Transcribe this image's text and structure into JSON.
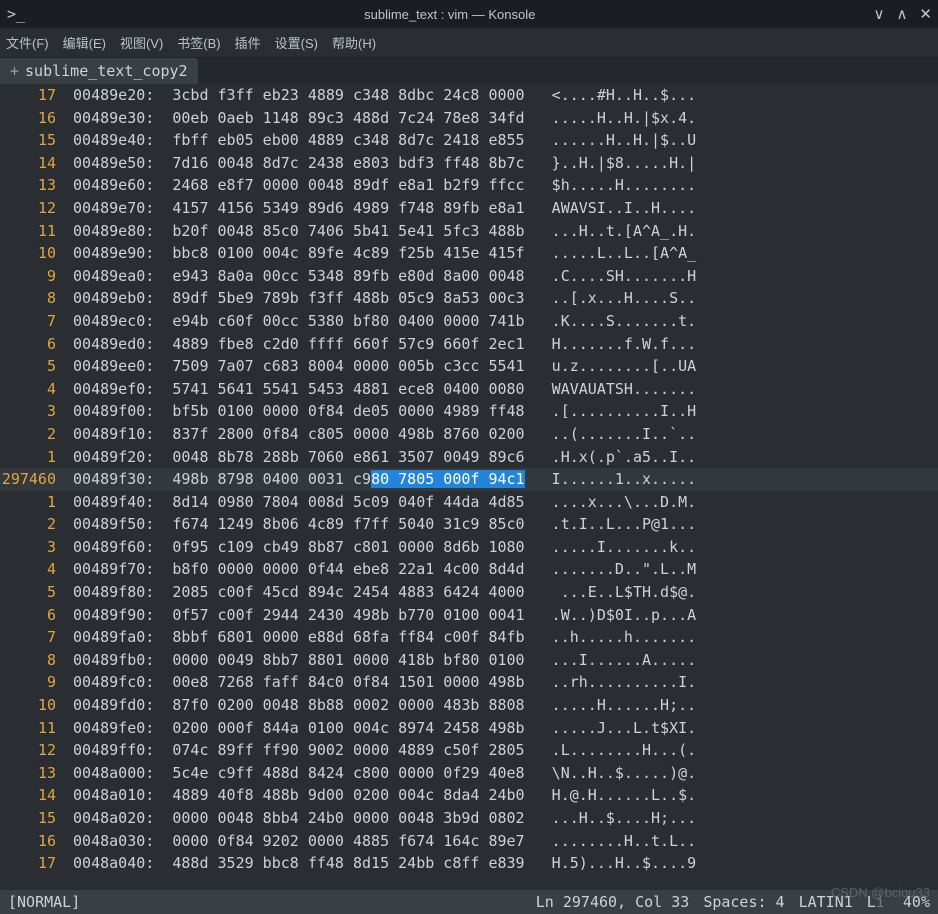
{
  "window": {
    "title": "sublime_text : vim — Konsole",
    "min_icon": "∨",
    "max_icon": "∧",
    "close_icon": "✕",
    "app_icon": ">_"
  },
  "menu": {
    "file": "文件(F)",
    "edit": "编辑(E)",
    "view": "视图(V)",
    "bookmarks": "书签(B)",
    "plugins": "插件",
    "settings": "设置(S)",
    "help": "帮助(H)"
  },
  "tabs": {
    "current": {
      "prefix": "+",
      "label": "sublime_text_copy2"
    }
  },
  "hex": {
    "cursor_row": 17,
    "cursor_col_start": 38,
    "rows": [
      {
        "ln": "17",
        "addr": "00489e20:",
        "bytes": "3cbd f3ff eb23 4889 c348 8dbc 24c8 0000",
        "ascii": "<....#H..H..$..."
      },
      {
        "ln": "16",
        "addr": "00489e30:",
        "bytes": "00eb 0aeb 1148 89c3 488d 7c24 78e8 34fd",
        "ascii": ".....H..H.|$x.4."
      },
      {
        "ln": "15",
        "addr": "00489e40:",
        "bytes": "fbff eb05 eb00 4889 c348 8d7c 2418 e855",
        "ascii": "......H..H.|$..U"
      },
      {
        "ln": "14",
        "addr": "00489e50:",
        "bytes": "7d16 0048 8d7c 2438 e803 bdf3 ff48 8b7c",
        "ascii": "}..H.|$8.....H.|"
      },
      {
        "ln": "13",
        "addr": "00489e60:",
        "bytes": "2468 e8f7 0000 0048 89df e8a1 b2f9 ffcc",
        "ascii": "$h.....H........"
      },
      {
        "ln": "12",
        "addr": "00489e70:",
        "bytes": "4157 4156 5349 89d6 4989 f748 89fb e8a1",
        "ascii": "AWAVSI..I..H...."
      },
      {
        "ln": "11",
        "addr": "00489e80:",
        "bytes": "b20f 0048 85c0 7406 5b41 5e41 5fc3 488b",
        "ascii": "...H..t.[A^A_.H."
      },
      {
        "ln": "10",
        "addr": "00489e90:",
        "bytes": "bbc8 0100 004c 89fe 4c89 f25b 415e 415f",
        "ascii": ".....L..L..[A^A_"
      },
      {
        "ln": "9",
        "addr": "00489ea0:",
        "bytes": "e943 8a0a 00cc 5348 89fb e80d 8a00 0048",
        "ascii": ".C....SH.......H"
      },
      {
        "ln": "8",
        "addr": "00489eb0:",
        "bytes": "89df 5be9 789b f3ff 488b 05c9 8a53 00c3",
        "ascii": "..[.x...H....S.."
      },
      {
        "ln": "7",
        "addr": "00489ec0:",
        "bytes": "e94b c60f 00cc 5380 bf80 0400 0000 741b",
        "ascii": ".K....S.......t."
      },
      {
        "ln": "6",
        "addr": "00489ed0:",
        "bytes": "4889 fbe8 c2d0 ffff 660f 57c9 660f 2ec1",
        "ascii": "H.......f.W.f..."
      },
      {
        "ln": "5",
        "addr": "00489ee0:",
        "bytes": "7509 7a07 c683 8004 0000 005b c3cc 5541",
        "ascii": "u.z........[..UA"
      },
      {
        "ln": "4",
        "addr": "00489ef0:",
        "bytes": "5741 5641 5541 5453 4881 ece8 0400 0080",
        "ascii": "WAVAUATSH......."
      },
      {
        "ln": "3",
        "addr": "00489f00:",
        "bytes": "bf5b 0100 0000 0f84 de05 0000 4989 ff48",
        "ascii": ".[..........I..H"
      },
      {
        "ln": "2",
        "addr": "00489f10:",
        "bytes": "837f 2800 0f84 c805 0000 498b 8760 0200",
        "ascii": "..(.......I..`.."
      },
      {
        "ln": "1",
        "addr": "00489f20:",
        "bytes": "0048 8b78 288b 7060 e861 3507 0049 89c6",
        "ascii": ".H.x(.p`.a5..I.."
      },
      {
        "ln": "297460",
        "addr": "00489f30:",
        "bytes_pre": "498b 8798 0400 0031 c9",
        "bytes_sel": "80 7805 000f 94c1",
        "ascii": "I......1..x.....",
        "is_cursor": true
      },
      {
        "ln": "1",
        "addr": "00489f40:",
        "bytes": "8d14 0980 7804 008d 5c09 040f 44da 4d85",
        "ascii": "....x...\\...D.M."
      },
      {
        "ln": "2",
        "addr": "00489f50:",
        "bytes": "f674 1249 8b06 4c89 f7ff 5040 31c9 85c0",
        "ascii": ".t.I..L...P@1..."
      },
      {
        "ln": "3",
        "addr": "00489f60:",
        "bytes": "0f95 c109 cb49 8b87 c801 0000 8d6b 1080",
        "ascii": ".....I.......k.."
      },
      {
        "ln": "4",
        "addr": "00489f70:",
        "bytes": "b8f0 0000 0000 0f44 ebe8 22a1 4c00 8d4d",
        "ascii": ".......D..\".L..M"
      },
      {
        "ln": "5",
        "addr": "00489f80:",
        "bytes": "2085 c00f 45cd 894c 2454 4883 6424 4000",
        "ascii": " ...E..L$TH.d$@."
      },
      {
        "ln": "6",
        "addr": "00489f90:",
        "bytes": "0f57 c00f 2944 2430 498b b770 0100 0041",
        "ascii": ".W..)D$0I..p...A"
      },
      {
        "ln": "7",
        "addr": "00489fa0:",
        "bytes": "8bbf 6801 0000 e88d 68fa ff84 c00f 84fb",
        "ascii": "..h.....h......."
      },
      {
        "ln": "8",
        "addr": "00489fb0:",
        "bytes": "0000 0049 8bb7 8801 0000 418b bf80 0100",
        "ascii": "...I......A....."
      },
      {
        "ln": "9",
        "addr": "00489fc0:",
        "bytes": "00e8 7268 faff 84c0 0f84 1501 0000 498b",
        "ascii": "..rh..........I."
      },
      {
        "ln": "10",
        "addr": "00489fd0:",
        "bytes": "87f0 0200 0048 8b88 0002 0000 483b 8808",
        "ascii": ".....H......H;.."
      },
      {
        "ln": "11",
        "addr": "00489fe0:",
        "bytes": "0200 000f 844a 0100 004c 8974 2458 498b",
        "ascii": ".....J...L.t$XI."
      },
      {
        "ln": "12",
        "addr": "00489ff0:",
        "bytes": "074c 89ff ff90 9002 0000 4889 c50f 2805",
        "ascii": ".L........H...(."
      },
      {
        "ln": "13",
        "addr": "0048a000:",
        "bytes": "5c4e c9ff 488d 8424 c800 0000 0f29 40e8",
        "ascii": "\\N..H..$.....)@."
      },
      {
        "ln": "14",
        "addr": "0048a010:",
        "bytes": "4889 40f8 488b 9d00 0200 004c 8da4 24b0",
        "ascii": "H.@.H......L..$."
      },
      {
        "ln": "15",
        "addr": "0048a020:",
        "bytes": "0000 0048 8bb4 24b0 0000 0048 3b9d 0802",
        "ascii": "...H..$....H;..."
      },
      {
        "ln": "16",
        "addr": "0048a030:",
        "bytes": "0000 0f84 9202 0000 4885 f674 164c 89e7",
        "ascii": "........H..t.L.."
      },
      {
        "ln": "17",
        "addr": "0048a040:",
        "bytes": "488d 3529 bbc8 ff48 8d15 24bb c8ff e839",
        "ascii": "H.5)...H..$....9"
      }
    ]
  },
  "status": {
    "mode": "[NORMAL]",
    "position": "Ln 297460, Col 33",
    "spaces": "Spaces: 4",
    "encoding": "LATIN1",
    "pct": "40%",
    "lang_prefix": "L"
  },
  "watermark": "CSDN @bciou33"
}
